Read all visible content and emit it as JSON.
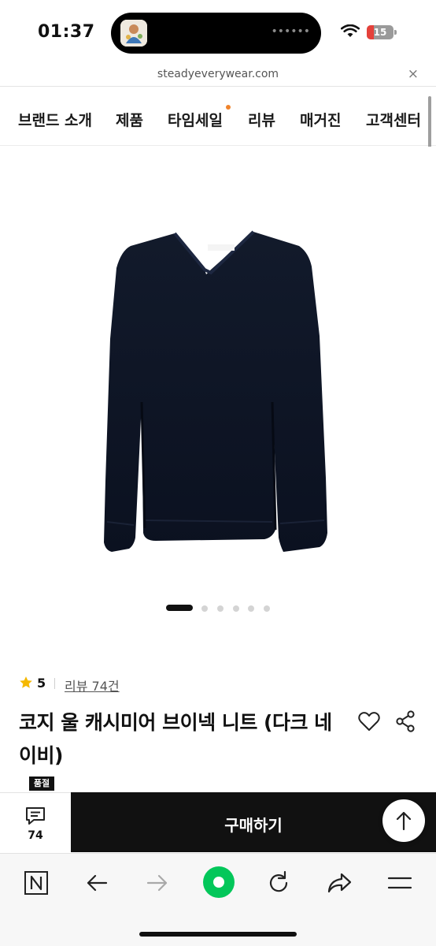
{
  "status_bar": {
    "time": "01:37",
    "battery": "15",
    "battery_level": 0.15,
    "island_dots": "••••••"
  },
  "browser": {
    "url": "steadyeverywear.com",
    "close_glyph": "×"
  },
  "nav": {
    "items": [
      {
        "label": "브랜드 소개"
      },
      {
        "label": "제품"
      },
      {
        "label": "타임세일",
        "has_dot": true
      },
      {
        "label": "리뷰"
      },
      {
        "label": "매거진"
      },
      {
        "label": "고객센터"
      }
    ],
    "dot_color": "#f0832b"
  },
  "gallery": {
    "slide_count": 6,
    "active_index": 0
  },
  "product": {
    "rating": "5",
    "review_link": "리뷰 74건",
    "title": "코지 울 캐시미어 브이넥 니트 (다크 네이비)",
    "badge": "품절",
    "star_color": "#f5b800"
  },
  "purchase_bar": {
    "review_count": "74",
    "buy_label": "구매하기"
  },
  "toolbar": {
    "icons": [
      "naver-n-icon",
      "back-arrow-icon",
      "forward-arrow-icon",
      "green-dot-icon",
      "reload-icon",
      "share-arrow-icon",
      "menu-icon"
    ],
    "accent_color": "#03c75a"
  }
}
